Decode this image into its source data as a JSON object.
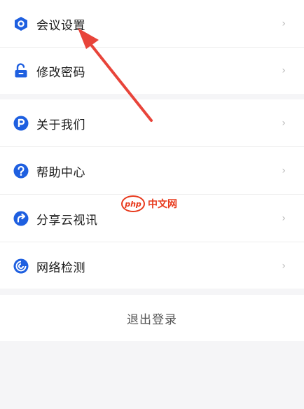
{
  "menu": {
    "items": [
      {
        "label": "会议设置",
        "icon": "hexagon-settings-icon"
      },
      {
        "label": "修改密码",
        "icon": "unlock-icon"
      },
      {
        "label": "关于我们",
        "icon": "p-badge-icon"
      },
      {
        "label": "帮助中心",
        "icon": "question-icon"
      },
      {
        "label": "分享云视讯",
        "icon": "share-arrow-icon"
      },
      {
        "label": "网络检测",
        "icon": "network-swirl-icon"
      }
    ],
    "chevron": "›"
  },
  "logout": {
    "label": "退出登录"
  },
  "watermark": {
    "logo": "php",
    "text": "中文网"
  },
  "colors": {
    "accent": "#1e5fe0",
    "annotation": "#e8443a",
    "watermark": "#e83a1d"
  }
}
